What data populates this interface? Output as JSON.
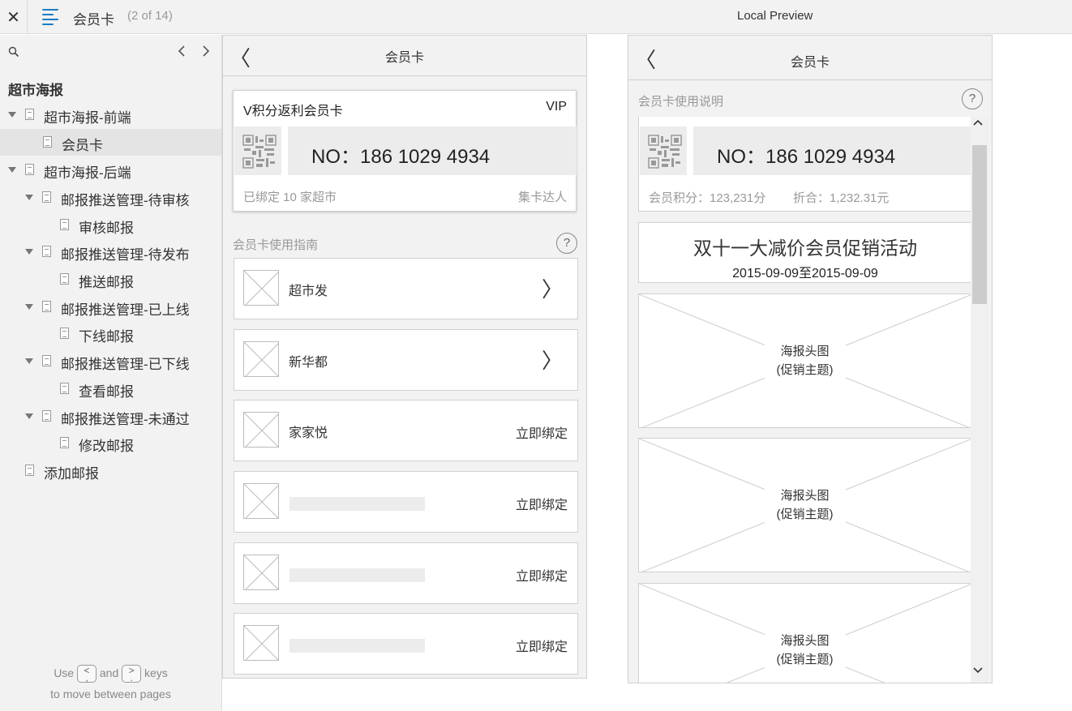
{
  "topbar": {
    "close_icon": "✕",
    "title": "会员卡",
    "count": "(2 of 14)",
    "preview_label": "Local Preview"
  },
  "sidebar": {
    "prev_icon": "‹",
    "next_icon": "›",
    "root": "超市海报",
    "items": [
      {
        "label": "超市海报-前端"
      },
      {
        "label": "会员卡"
      },
      {
        "label": "超市海报-后端"
      },
      {
        "label": "邮报推送管理-待审核"
      },
      {
        "label": "审核邮报"
      },
      {
        "label": "邮报推送管理-待发布"
      },
      {
        "label": "推送邮报"
      },
      {
        "label": "邮报推送管理-已上线"
      },
      {
        "label": "下线邮报"
      },
      {
        "label": "邮报推送管理-已下线"
      },
      {
        "label": "查看邮报"
      },
      {
        "label": "邮报推送管理-未通过"
      },
      {
        "label": "修改邮报"
      },
      {
        "label": "添加邮报"
      }
    ],
    "hint": {
      "use": "Use",
      "key_prev": "<\n,",
      "and": "and",
      "key_next": ">\n.",
      "keys": "keys",
      "line2": "to move between pages"
    }
  },
  "left_panel": {
    "back_icon": "〈",
    "title": "会员卡",
    "card": {
      "name": "V积分返利会员卡",
      "level": "VIP",
      "number": "NO：186 1029 4934",
      "bound": "已绑定 10 家超市",
      "badge": "集卡达人"
    },
    "guide_label": "会员卡使用指南",
    "help_icon": "?",
    "stores": [
      {
        "name": "超市发",
        "action": "〉"
      },
      {
        "name": "新华都",
        "action": "〉"
      },
      {
        "name": "家家悦",
        "action": "立即绑定"
      },
      {
        "name": "",
        "action": "立即绑定"
      },
      {
        "name": "",
        "action": "立即绑定"
      },
      {
        "name": "",
        "action": "立即绑定"
      }
    ]
  },
  "right_panel": {
    "back_icon": "〈",
    "title": "会员卡",
    "usage_label": "会员卡使用说明",
    "help_icon": "?",
    "card": {
      "number": "NO：186 1029 4934",
      "points": "会员积分：123,231分",
      "discount": "折合：1,232.31元"
    },
    "promo": {
      "title": "双十一大减价会员促销活动",
      "dates": "2015-09-09至2015-09-09"
    },
    "posters": [
      {
        "line1": "海报头图",
        "line2": "(促销主题)"
      },
      {
        "line1": "海报头图",
        "line2": "(促销主题)"
      },
      {
        "line1": "海报头图",
        "line2": "(促销主题)"
      }
    ],
    "scroll_up_icon": "⌃",
    "scroll_down_icon": "⌄"
  }
}
